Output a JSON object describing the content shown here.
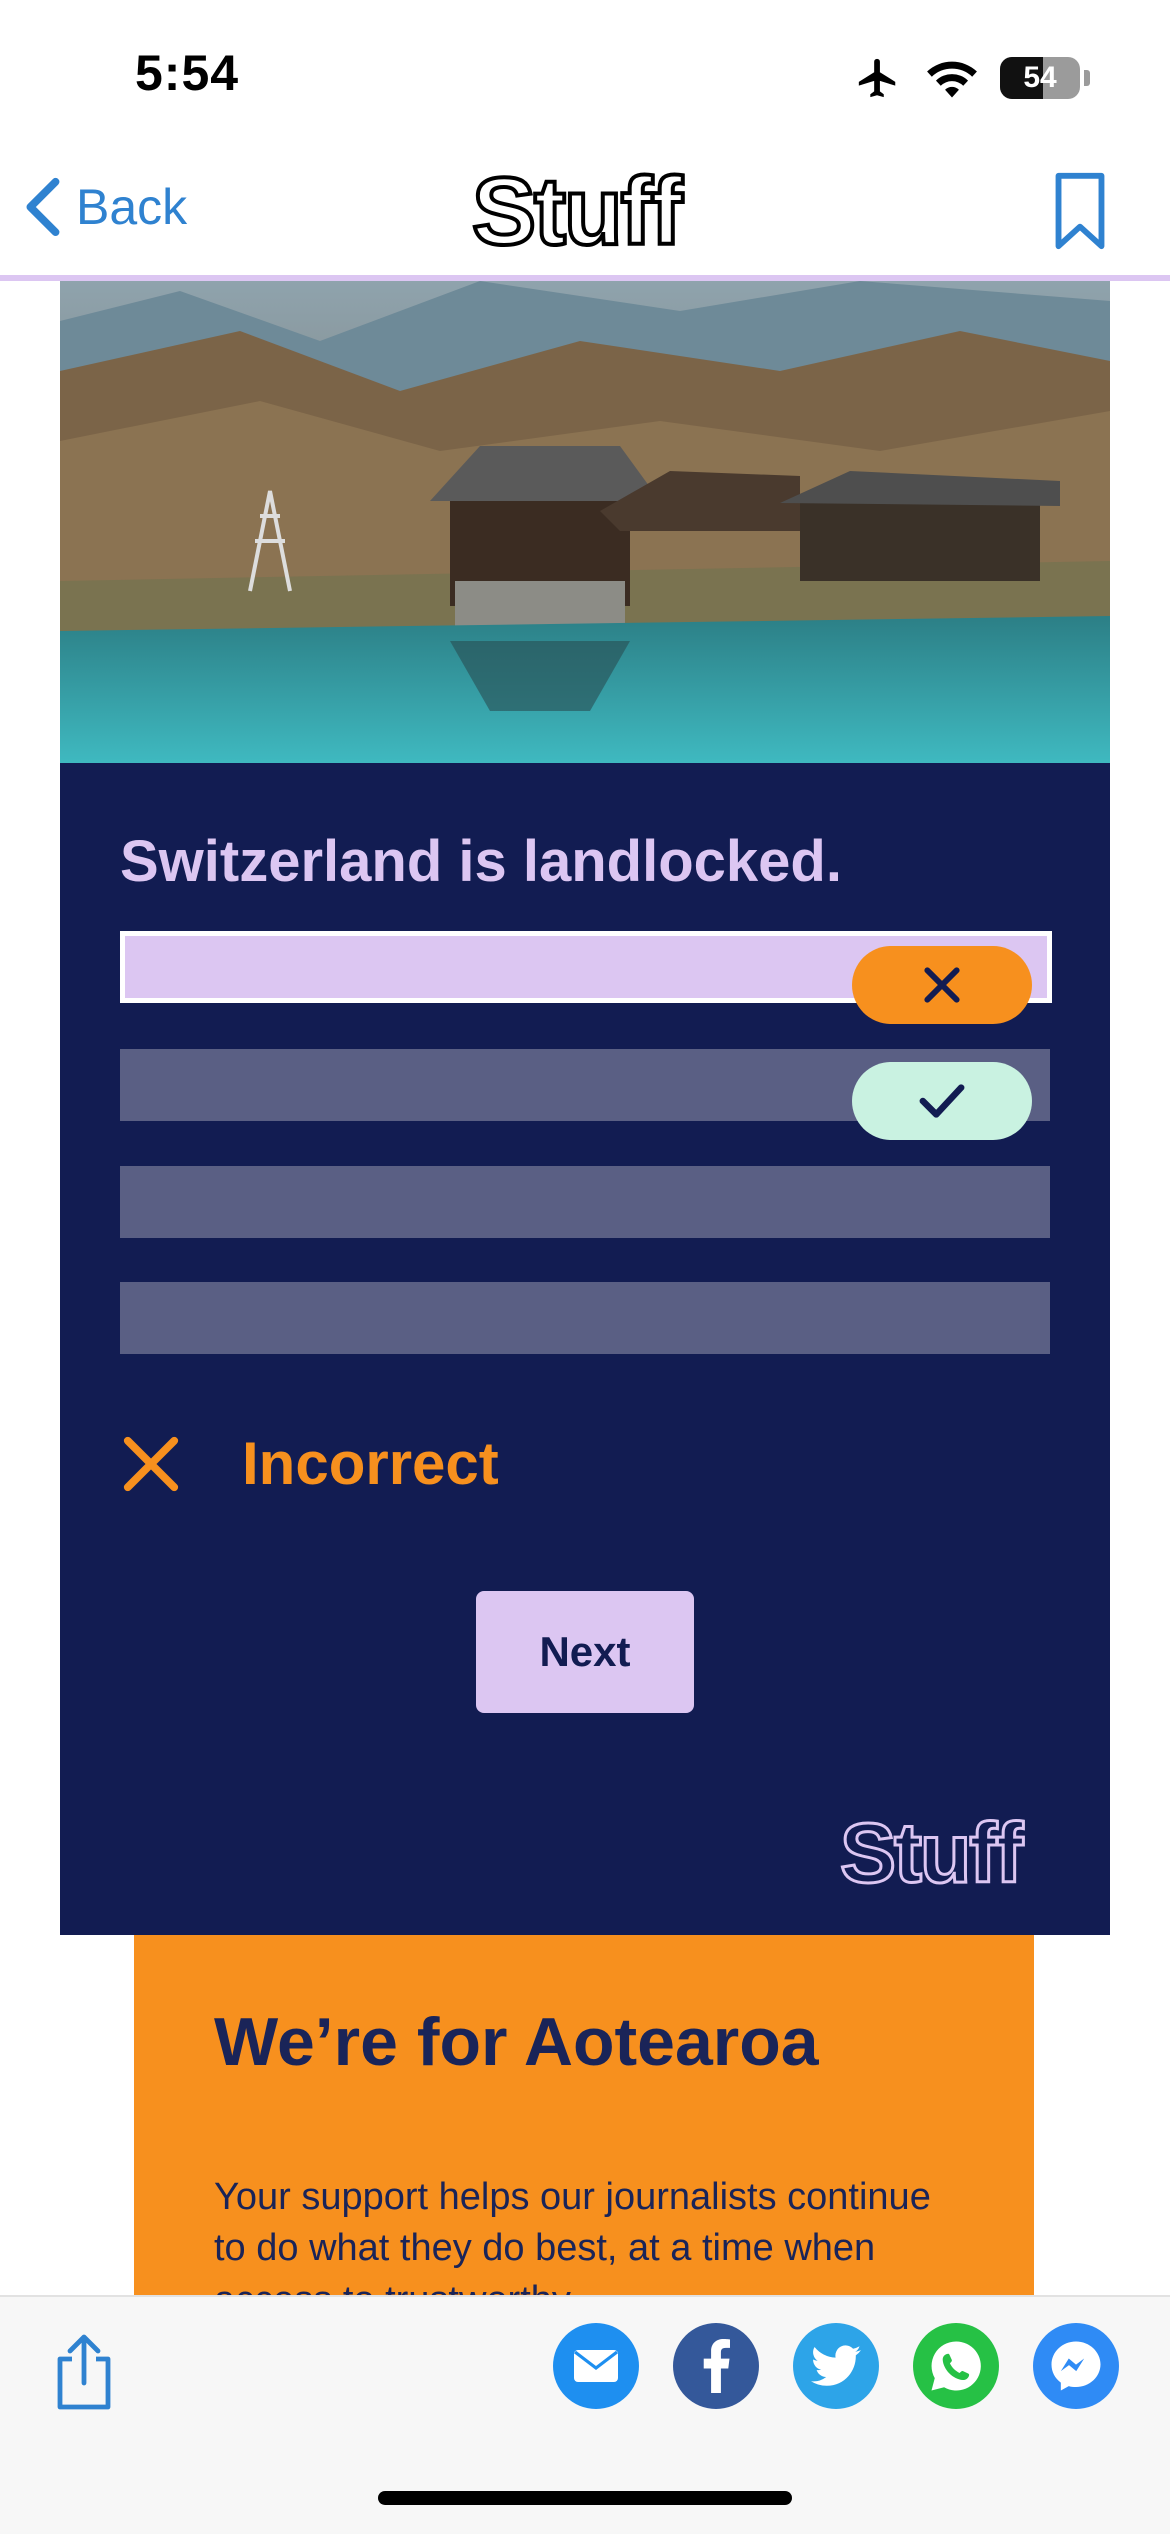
{
  "status_bar": {
    "time": "5:54",
    "battery": "54"
  },
  "nav": {
    "back_label": "Back",
    "logo": "Stuff"
  },
  "quiz": {
    "question": "Switzerland is landlocked.",
    "result": "Incorrect",
    "next_label": "Next",
    "card_logo": "Stuff"
  },
  "promo": {
    "title": "We’re for Aotearoa",
    "body": "Your support helps our journalists continue to do what they do best, at a time when access to trustworthy"
  },
  "colors": {
    "accent_blue": "#2f82d0",
    "card_navy": "#121c52",
    "lilac": "#dcc6f2",
    "orange": "#f7901e",
    "mint": "#c9f2e1"
  },
  "icons": {
    "nav": [
      "chevron-left-icon",
      "bookmark-icon"
    ],
    "status": [
      "airplane-icon",
      "wifi-icon",
      "battery-icon"
    ],
    "quiz": [
      "close-icon",
      "checkmark-icon",
      "incorrect-icon"
    ],
    "share": [
      "share-icon",
      "email-icon",
      "facebook-icon",
      "twitter-icon",
      "whatsapp-icon",
      "messenger-icon"
    ]
  }
}
